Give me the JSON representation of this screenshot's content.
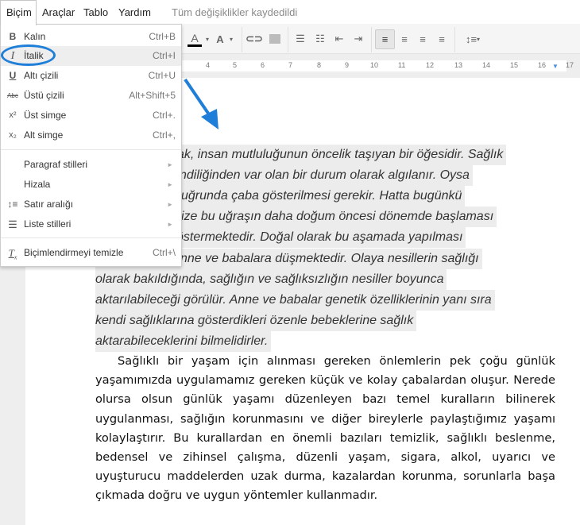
{
  "menubar": {
    "items": [
      "Biçim",
      "Araçlar",
      "Tablo",
      "Yardım"
    ],
    "status": "Tüm değişiklikler kaydedildi"
  },
  "toolbar": {
    "buttons": [
      "text-color",
      "highlight-color",
      "link",
      "image",
      "numbered-list",
      "bulleted-list",
      "decrease-indent",
      "increase-indent",
      "align-left",
      "align-center",
      "align-right",
      "justify",
      "line-spacing"
    ],
    "active": "align-left"
  },
  "ruler": {
    "ticks": [
      "4",
      "5",
      "6",
      "7",
      "8",
      "9",
      "10",
      "11",
      "12",
      "13",
      "14",
      "15",
      "16",
      "17"
    ]
  },
  "menu": {
    "items": [
      {
        "icon": "bold-icon",
        "label": "Kalın",
        "shortcut": "Ctrl+B"
      },
      {
        "icon": "italic-icon",
        "label": "İtalik",
        "shortcut": "Ctrl+I"
      },
      {
        "icon": "underline-icon",
        "label": "Altı çizili",
        "shortcut": "Ctrl+U"
      },
      {
        "icon": "strikethrough-icon",
        "label": "Üstü çizili",
        "shortcut": "Alt+Shift+5"
      },
      {
        "icon": "superscript-icon",
        "label": "Üst simge",
        "shortcut": "Ctrl+."
      },
      {
        "icon": "subscript-icon",
        "label": "Alt simge",
        "shortcut": "Ctrl+,"
      }
    ],
    "submenus": [
      {
        "icon": "",
        "label": "Paragraf stilleri"
      },
      {
        "icon": "",
        "label": "Hizala"
      },
      {
        "icon": "line-spacing-icon",
        "label": "Satır aralığı"
      },
      {
        "icon": "list-icon",
        "label": "Liste stilleri"
      }
    ],
    "clear": {
      "icon": "clear-formatting-icon",
      "label": "Biçimlendirmeyi temizle",
      "shortcut": "Ctrl+\\"
    }
  },
  "document": {
    "italic_lines": [
      "ak, insan mutluluğunun öncelik taşıyan bir öğesidir. Sağlık",
      "ndiliğinden var olan bir durum olarak algılanır. Oysa",
      "uğrunda çaba gösterilmesi gerekir. Hatta bugünkü",
      "ize bu uğraşın daha doğum öncesi dönemde başlaması",
      "östermektedir. Doğal olarak bu aşamada yapılması",
      "nne ve babalara düşmektedir. Olaya nesillerin sağlığı",
      "olarak bakıldığında, sağlığın ve sağlıksızlığın nesiller boyunca",
      "aktarılabileceği görülür. Anne ve babalar genetik özelliklerinin yanı sıra",
      "kendi sağlıklarına gösterdikleri özenle bebeklerine sağlık",
      "aktarabileceklerini bilmelidirler."
    ],
    "paragraph": "Sağlıklı bir yaşam için alınması gereken önlemlerin pek çoğu günlük yaşamımızda  uygulamamız gereken küçük ve kolay çabalardan oluşur. Nerede olursa olsun günlük yaşamı düzenleyen bazı temel kuralların bilinerek uygulanması, sağlığın korunmasını ve diğer bireylerle paylaştığımız yaşamı kolaylaştırır. Bu kurallardan en önemli bazıları temizlik, sağlıklı beslenme, bedensel ve zihinsel çalışma, düzenli yaşam, sigara, alkol, uyarıcı ve uyuşturucu maddelerden uzak durma, kazalardan korunma, sorunlarla başa çıkmada doğru ve uygun yöntemler kullanmadır."
  },
  "colors": {
    "annotation": "#1f7fd8",
    "highlight": "#ececec"
  }
}
